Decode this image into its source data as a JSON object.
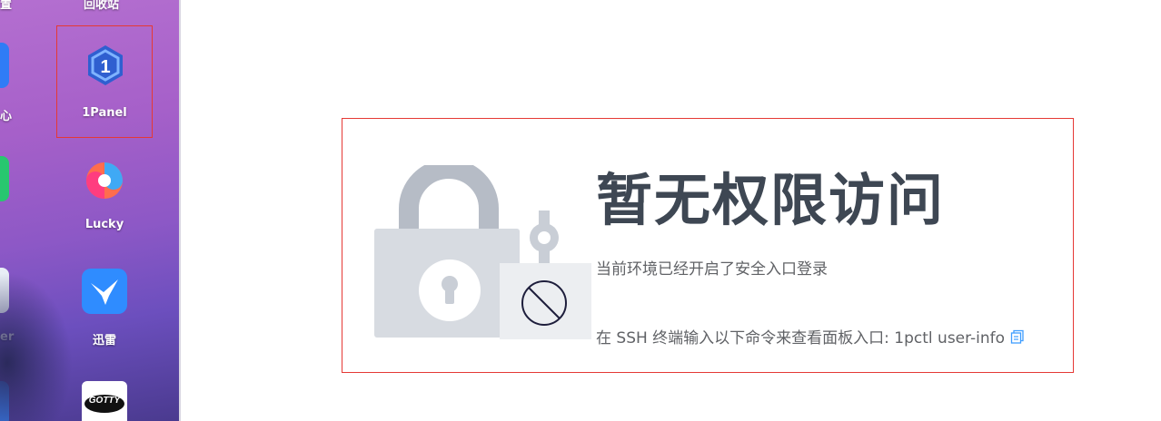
{
  "desktop": {
    "top_partial_labels": [
      "置",
      "回收站"
    ],
    "left_partial_labels": [
      "心",
      "er"
    ],
    "apps": [
      {
        "label": "1Panel",
        "icon": "1panel-icon",
        "selected": true
      },
      {
        "label": "Lucky",
        "icon": "lucky-swirl-icon"
      },
      {
        "label": "迅雷",
        "icon": "thunder-bird-icon"
      },
      {
        "label": "GOTTY",
        "icon": "gotty-icon"
      }
    ]
  },
  "main": {
    "title": "暂无权限访问",
    "description": "当前环境已经开启了安全入口登录",
    "command_text": "在 SSH 终端输入以下命令来查看面板入口: 1pctl user-info",
    "copy_icon": "copy-icon"
  },
  "colors": {
    "highlight_border": "#e53935",
    "title": "#3e4753",
    "text": "#606266",
    "link": "#409eff"
  }
}
